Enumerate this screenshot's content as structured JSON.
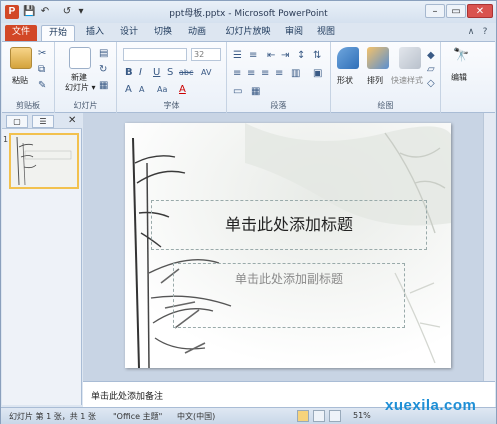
{
  "window": {
    "title": "ppt母板.pptx - Microsoft PowerPoint",
    "app_logo": "P",
    "qat": {
      "save": "💾",
      "undo": "↶",
      "redo": "↺",
      "customize": "▾"
    },
    "controls": {
      "minimize": "–",
      "maximize": "▭",
      "close": "✕"
    }
  },
  "tabs": [
    "文件",
    "开始",
    "插入",
    "设计",
    "切换",
    "动画",
    "幻灯片放映",
    "审阅",
    "视图"
  ],
  "tab_icons": {
    "collapse": "∧",
    "help": "?"
  },
  "ribbon": {
    "clipboard": {
      "paste": "粘贴",
      "label": "剪贴板"
    },
    "slides": {
      "new_slide_line1": "新建",
      "new_slide_line2": "幻灯片 ▾",
      "label": "幻灯片"
    },
    "font": {
      "font_name": "",
      "font_size": "32",
      "bold": "B",
      "italic": "I",
      "underline": "U",
      "shadow": "S",
      "strike": "abc",
      "spacing": "AV",
      "grow": "A",
      "shrink": "A",
      "clear": "Aa",
      "color": "A",
      "label": "字体"
    },
    "paragraph": {
      "label": "段落"
    },
    "drawing": {
      "shapes": "形状",
      "arrange": "排列",
      "quick_styles": "快速样式",
      "label": "绘图"
    },
    "editing": {
      "edit": "编辑",
      "find_icon": "🔭"
    }
  },
  "left_pane": {
    "tab_slides": "▢",
    "tab_outline": "☰",
    "close": "✕",
    "slide_number": "1"
  },
  "slide": {
    "title_placeholder": "单击此处添加标题",
    "subtitle_placeholder": "单击此处添加副标题"
  },
  "notes": {
    "placeholder": "单击此处添加备注"
  },
  "statusbar": {
    "slide_info": "幻灯片 第 1 张，共 1 张",
    "theme": "\"Office 主题\"",
    "language": "中文(中国)",
    "zoom": "51%"
  },
  "watermark": "xuexila.com",
  "colors": {
    "file_tab": "#d24726",
    "ribbon_bg": "#fbfcfe",
    "thumb_selected": "#f2c14e",
    "watermark": "#1e8fd6"
  }
}
